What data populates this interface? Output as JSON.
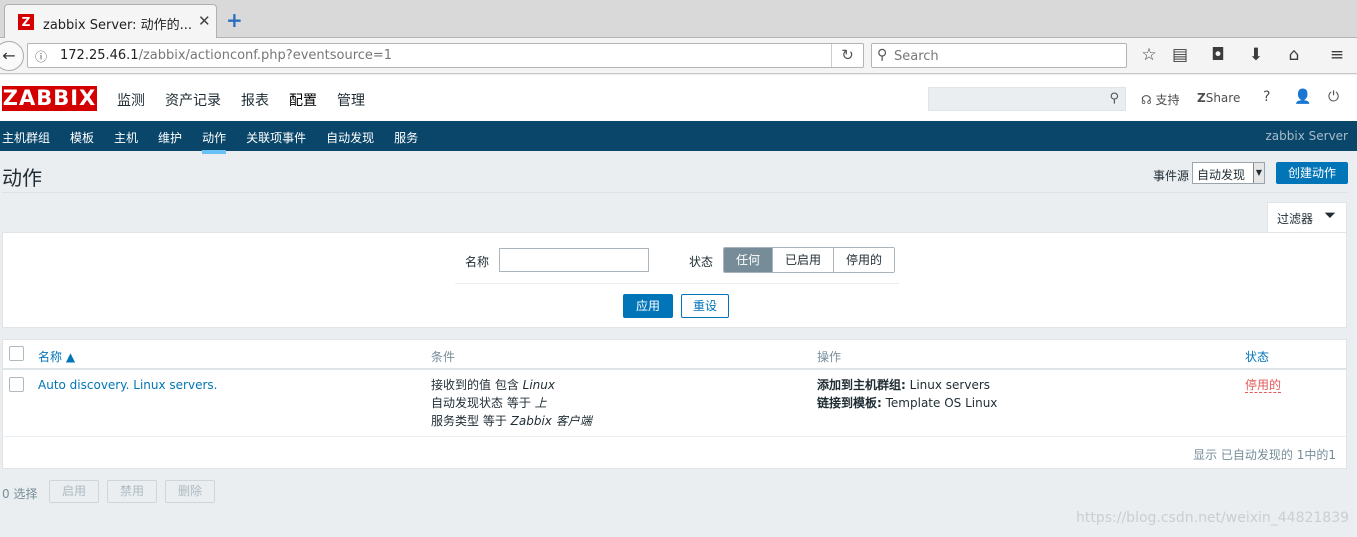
{
  "browser": {
    "tab_title": "zabbix Server: 动作的...",
    "tab_favicon": "Z",
    "url_host": "172.25.46.1",
    "url_path": "/zabbix/actionconf.php?eventsource=1",
    "search_placeholder": "Search"
  },
  "header": {
    "logo": "ZABBIX",
    "menu": [
      "监测",
      "资产记录",
      "报表",
      "配置",
      "管理"
    ],
    "active_menu": "配置",
    "support_label": "支持",
    "share_label": "Share",
    "help_icon": "?"
  },
  "subnav": {
    "items": [
      "主机群组",
      "模板",
      "主机",
      "维护",
      "动作",
      "关联项事件",
      "自动发现",
      "服务"
    ],
    "active": "动作",
    "server_name": "zabbix Server"
  },
  "page": {
    "title": "动作",
    "event_source_label": "事件源",
    "event_source_value": "自动发现",
    "create_button": "创建动作"
  },
  "filter": {
    "tab_label": "过滤器",
    "name_label": "名称",
    "name_value": "",
    "status_label": "状态",
    "status_options": [
      "任何",
      "已启用",
      "停用的"
    ],
    "status_selected": "任何",
    "apply_button": "应用",
    "reset_button": "重设"
  },
  "table": {
    "columns": {
      "name": "名称 ▲",
      "conditions": "条件",
      "operations": "操作",
      "status": "状态"
    },
    "rows": [
      {
        "name": "Auto discovery. Linux servers.",
        "conditions": [
          {
            "prefix": "接收到的值 包含 ",
            "italic": "Linux"
          },
          {
            "prefix": "自动发现状态 等于 ",
            "italic": "上"
          },
          {
            "prefix": "服务类型 等于 ",
            "italic": "Zabbix 客户端"
          }
        ],
        "operations": [
          {
            "label": "添加到主机群组:",
            "value": " Linux servers"
          },
          {
            "label": "链接到模板:",
            "value": " Template OS Linux"
          }
        ],
        "status": "停用的"
      }
    ],
    "footer": "显示 已自动发现的 1中的1"
  },
  "bottom": {
    "selected": "0 选择",
    "enable_button": "启用",
    "disable_button": "禁用",
    "delete_button": "删除"
  },
  "watermark": "https://blog.csdn.net/weixin_44821839",
  "colors": {
    "brand_red": "#d40000",
    "primary_blue": "#0275b8",
    "subnav_bg": "#0a466a",
    "disabled_status": "#e45959"
  }
}
